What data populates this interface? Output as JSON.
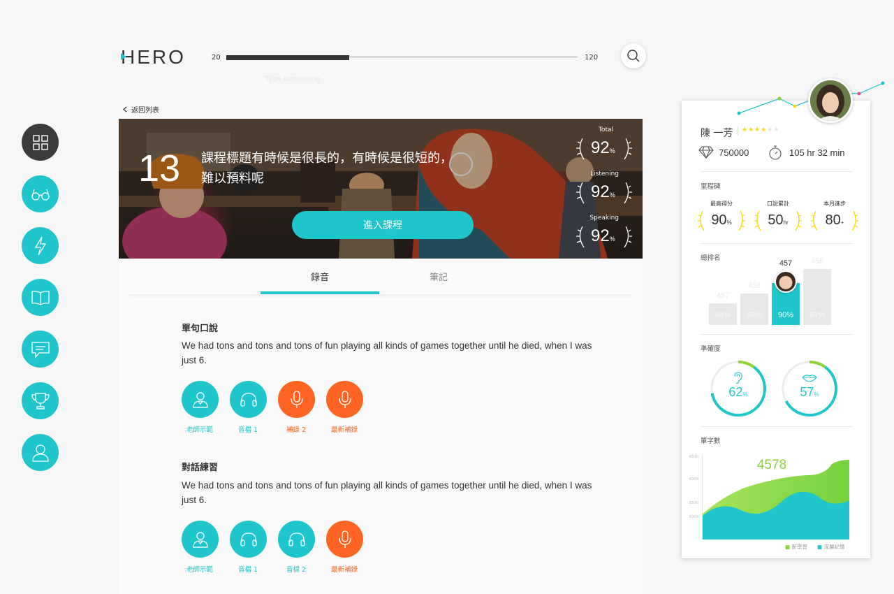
{
  "app": {
    "logo": "HERO"
  },
  "progress": {
    "min": "20",
    "max": "120",
    "current": 55,
    "hint": "Type something"
  },
  "back": {
    "label": "返回列表"
  },
  "nav": [
    {
      "name": "grid",
      "active": true
    },
    {
      "name": "glasses",
      "active": false
    },
    {
      "name": "lightning",
      "active": false
    },
    {
      "name": "book",
      "active": false
    },
    {
      "name": "chat",
      "active": false
    },
    {
      "name": "trophy",
      "active": false
    },
    {
      "name": "user",
      "active": false
    }
  ],
  "lesson": {
    "number": "13",
    "title": "課程標題有時候是很長的，有時候是很短的，難以預料呢",
    "enter_label": "進入課程",
    "scores": [
      {
        "label": "Total",
        "value": "92",
        "unit": "%"
      },
      {
        "label": "Listening",
        "value": "92",
        "unit": "%"
      },
      {
        "label": "Speaking",
        "value": "92",
        "unit": "%"
      }
    ]
  },
  "tabs": [
    {
      "label": "錄音",
      "active": true
    },
    {
      "label": "筆記",
      "active": false
    }
  ],
  "sections": [
    {
      "title": "單句口說",
      "text": "We had tons and tons and tons of fun playing all kinds of games together until he died, when I was just 6.",
      "actions": [
        {
          "label": "老師示範",
          "icon": "teacher-icon",
          "color": "teal"
        },
        {
          "label": "音檔 1",
          "icon": "headphones-icon",
          "color": "teal"
        },
        {
          "label": "補錄 2",
          "icon": "microphone-icon",
          "color": "orange"
        },
        {
          "label": "最新補錄",
          "icon": "microphone-icon",
          "color": "orange"
        }
      ]
    },
    {
      "title": "對話練習",
      "text": "We had tons and tons and tons of fun playing all kinds of games together until he died, when I was just 6.",
      "actions": [
        {
          "label": "老師示範",
          "icon": "teacher-icon",
          "color": "teal"
        },
        {
          "label": "音檔 1",
          "icon": "headphones-icon",
          "color": "teal"
        },
        {
          "label": "音檔 2",
          "icon": "headphones-icon",
          "color": "teal"
        },
        {
          "label": "最新補錄",
          "icon": "microphone-icon",
          "color": "orange"
        }
      ]
    }
  ],
  "profile": {
    "name": "陳 一芳",
    "stars": 4,
    "stars_max": 6,
    "points": "750000",
    "time": "105 hr 32 min",
    "milestone_title": "里程碑",
    "milestones": [
      {
        "label": "最高得分",
        "value": "90",
        "unit": "%"
      },
      {
        "label": "口說累計",
        "value": "50",
        "unit": "hr"
      },
      {
        "label": "本月進步",
        "value": "80",
        "unit": "+"
      }
    ],
    "ranking_title": "總排名",
    "ranking": [
      {
        "rank": "457",
        "percent": "84%",
        "value": 0.25,
        "highlight": false
      },
      {
        "rank": "458",
        "percent": "88%",
        "value": 0.36,
        "highlight": false
      },
      {
        "rank": "457",
        "percent": "90%",
        "value": 0.48,
        "highlight": true
      },
      {
        "rank": "456",
        "percent": "91%",
        "value": 0.64,
        "highlight": false
      }
    ],
    "accuracy_title": "準確度",
    "accuracy": [
      {
        "value": "62",
        "unit": "%",
        "icon": "ear-icon",
        "fraction": 0.62
      },
      {
        "value": "57",
        "unit": "%",
        "icon": "lips-icon",
        "fraction": 0.57
      }
    ],
    "words_title": "單字數",
    "words_total": "4578",
    "word_axis": [
      "4500",
      "4000",
      "3500",
      "3000"
    ],
    "legend": [
      "新學習",
      "深層記憶"
    ],
    "colors": {
      "teal": "#1ec6cb",
      "orange": "#ff6422",
      "green": "#8cd43a",
      "star": "#f5d70a"
    }
  }
}
